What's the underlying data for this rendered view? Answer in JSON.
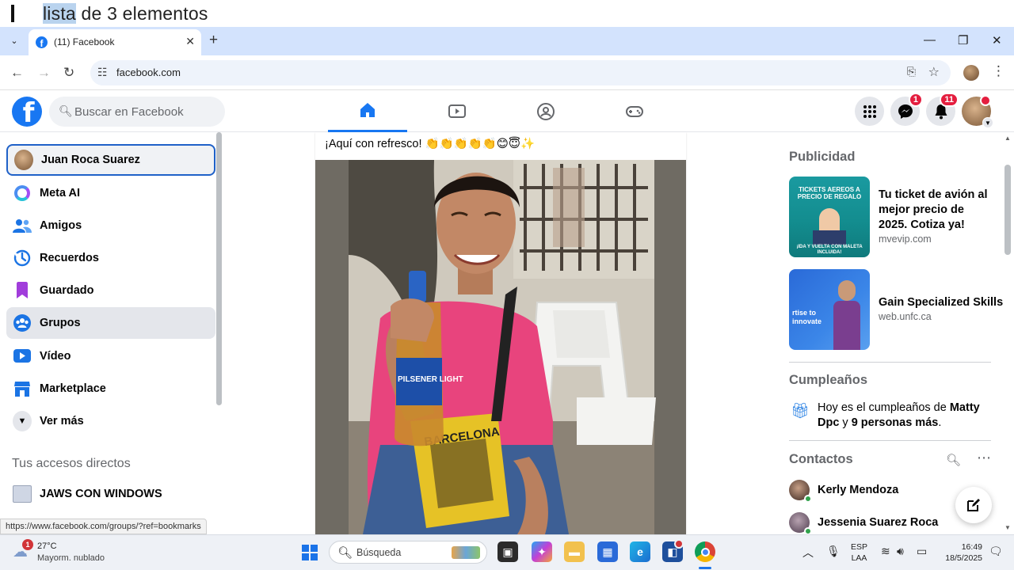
{
  "speech": {
    "highlighted": "lista",
    "rest": " de 3 elementos"
  },
  "browser": {
    "tab_title": "(11) Facebook",
    "tab_favicon": "f",
    "url": "facebook.com",
    "new_tab": "+",
    "close_tab": "✕",
    "tab_list": "⌄",
    "controls": {
      "minimize": "—",
      "restore": "❐",
      "close": "✕"
    },
    "nav": {
      "back": "←",
      "forward": "→",
      "reload": "↻"
    }
  },
  "facebook": {
    "logo": "f",
    "search_placeholder": "Buscar en Facebook",
    "messenger_badge": "1",
    "notifications_badge": "11",
    "sidebar": [
      {
        "label": "Juan Roca Suarez",
        "icon": "profile-avatar"
      },
      {
        "label": "Meta AI",
        "icon": "meta-ai-icon"
      },
      {
        "label": "Amigos",
        "icon": "friends-icon"
      },
      {
        "label": "Recuerdos",
        "icon": "memories-icon"
      },
      {
        "label": "Guardado",
        "icon": "saved-icon"
      },
      {
        "label": "Grupos",
        "icon": "groups-icon"
      },
      {
        "label": "Vídeo",
        "icon": "video-icon"
      },
      {
        "label": "Marketplace",
        "icon": "marketplace-icon"
      },
      {
        "label": "Ver más",
        "icon": "chevron-down-icon"
      }
    ],
    "shortcuts_title": "Tus accesos directos",
    "shortcuts": [
      {
        "label": "JAWS CON WINDOWS"
      }
    ],
    "status_url": "https://www.facebook.com/groups/?ref=bookmarks",
    "post": {
      "text": "¡Aquí con refresco! 👏👏👏👏👏😊😇✨",
      "bottle_label": "PILSENER LIGHT",
      "bag_label": "BARCELONA"
    },
    "ads_title": "Publicidad",
    "ads": [
      {
        "title": "Tu ticket de avión al mejor precio de 2025. Cotiza ya!",
        "domain": "mvevip.com",
        "thumb_heading": "TICKETS AEREOS A PRECIO DE REGALO",
        "thumb_footer": "¡IDA Y VUELTA CON MALETA INCLUIDA!"
      },
      {
        "title": "Gain Specialized Skills",
        "domain": "web.unfc.ca",
        "thumb_text": "rtise to innovate"
      }
    ],
    "birthdays_title": "Cumpleaños",
    "birthday": {
      "prefix": "Hoy es el cumpleaños de ",
      "name": "Matty Dpc",
      "middle": " y ",
      "others": "9 personas más",
      "suffix": "."
    },
    "contacts_title": "Contactos",
    "contacts": [
      {
        "name": "Kerly Mendoza"
      },
      {
        "name": "Jessenia Suarez Roca"
      }
    ]
  },
  "taskbar": {
    "weather_badge": "1",
    "temperature": "27°C",
    "weather": "Mayorm. nublado",
    "search_placeholder": "Búsqueda",
    "lang_top": "ESP",
    "lang_bottom": "LAA",
    "time": "16:49",
    "date": "18/5/2025"
  },
  "colors": {
    "fb_blue": "#1877f2",
    "badge_red": "#e41e3f",
    "tabstrip": "#d3e3fd"
  }
}
